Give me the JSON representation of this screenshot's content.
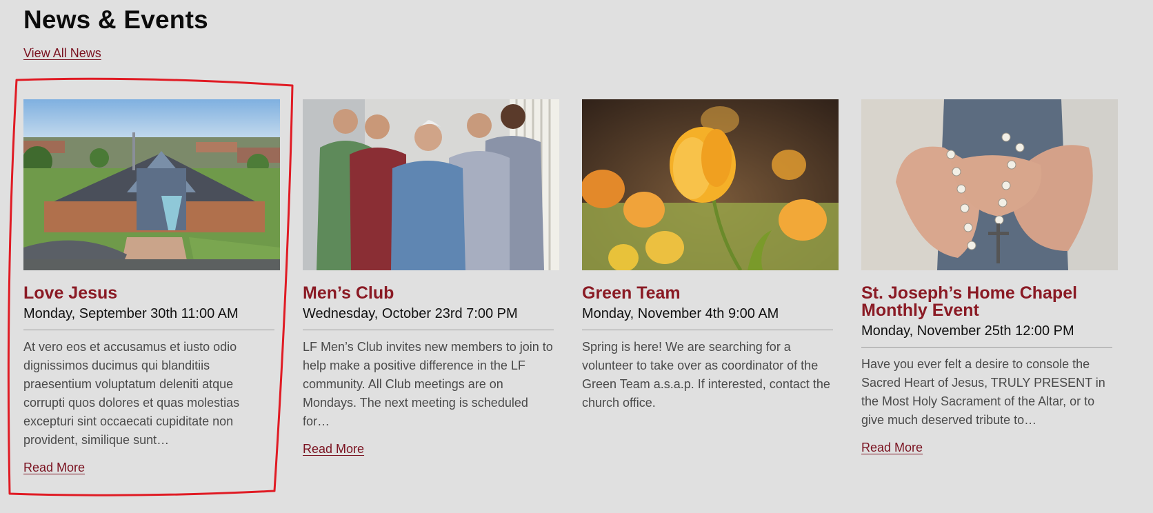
{
  "section": {
    "title": "News & Events",
    "view_all": "View All News"
  },
  "cards": [
    {
      "image": "church-aerial-photo",
      "title": "Love Jesus",
      "date": "Monday, September 30th 11:00 AM",
      "description": "At vero eos et accusamus et iusto odio dignissimos ducimus qui blanditiis praesentium voluptatum deleniti atque corrupti quos dolores et quas molestias excepturi sint occaecati cupiditate non provident, similique sunt…",
      "read_more": "Read More"
    },
    {
      "image": "group-of-men-photo",
      "title": "Men’s Club",
      "date": "Wednesday, October 23rd 7:00 PM",
      "description": "LF Men’s Club invites new members to join to help make a positive difference in the LF community. All Club meetings are on Mondays. The next meeting is scheduled for…",
      "read_more": "Read More"
    },
    {
      "image": "yellow-tulips-photo",
      "title": "Green Team",
      "date": "Monday, November 4th 9:00 AM",
      "description": "Spring is here! We are searching for a volunteer to take over as coordinator of the Green Team a.s.a.p. If interested, contact the church office.",
      "read_more": ""
    },
    {
      "image": "hands-with-rosary-photo",
      "title": "St. Joseph’s Home Chapel Monthly Event",
      "date": "Monday, November 25th 12:00 PM",
      "description": "Have you ever felt a desire to console the Sacred Heart of Jesus, TRULY PRESENT in the Most Holy Sacrament of the Altar, or to give much deserved tribute to…",
      "read_more": "Read More"
    }
  ],
  "colors": {
    "background": "#e0e0e0",
    "accent": "#8a1a24",
    "annotation": "#e01b24"
  }
}
